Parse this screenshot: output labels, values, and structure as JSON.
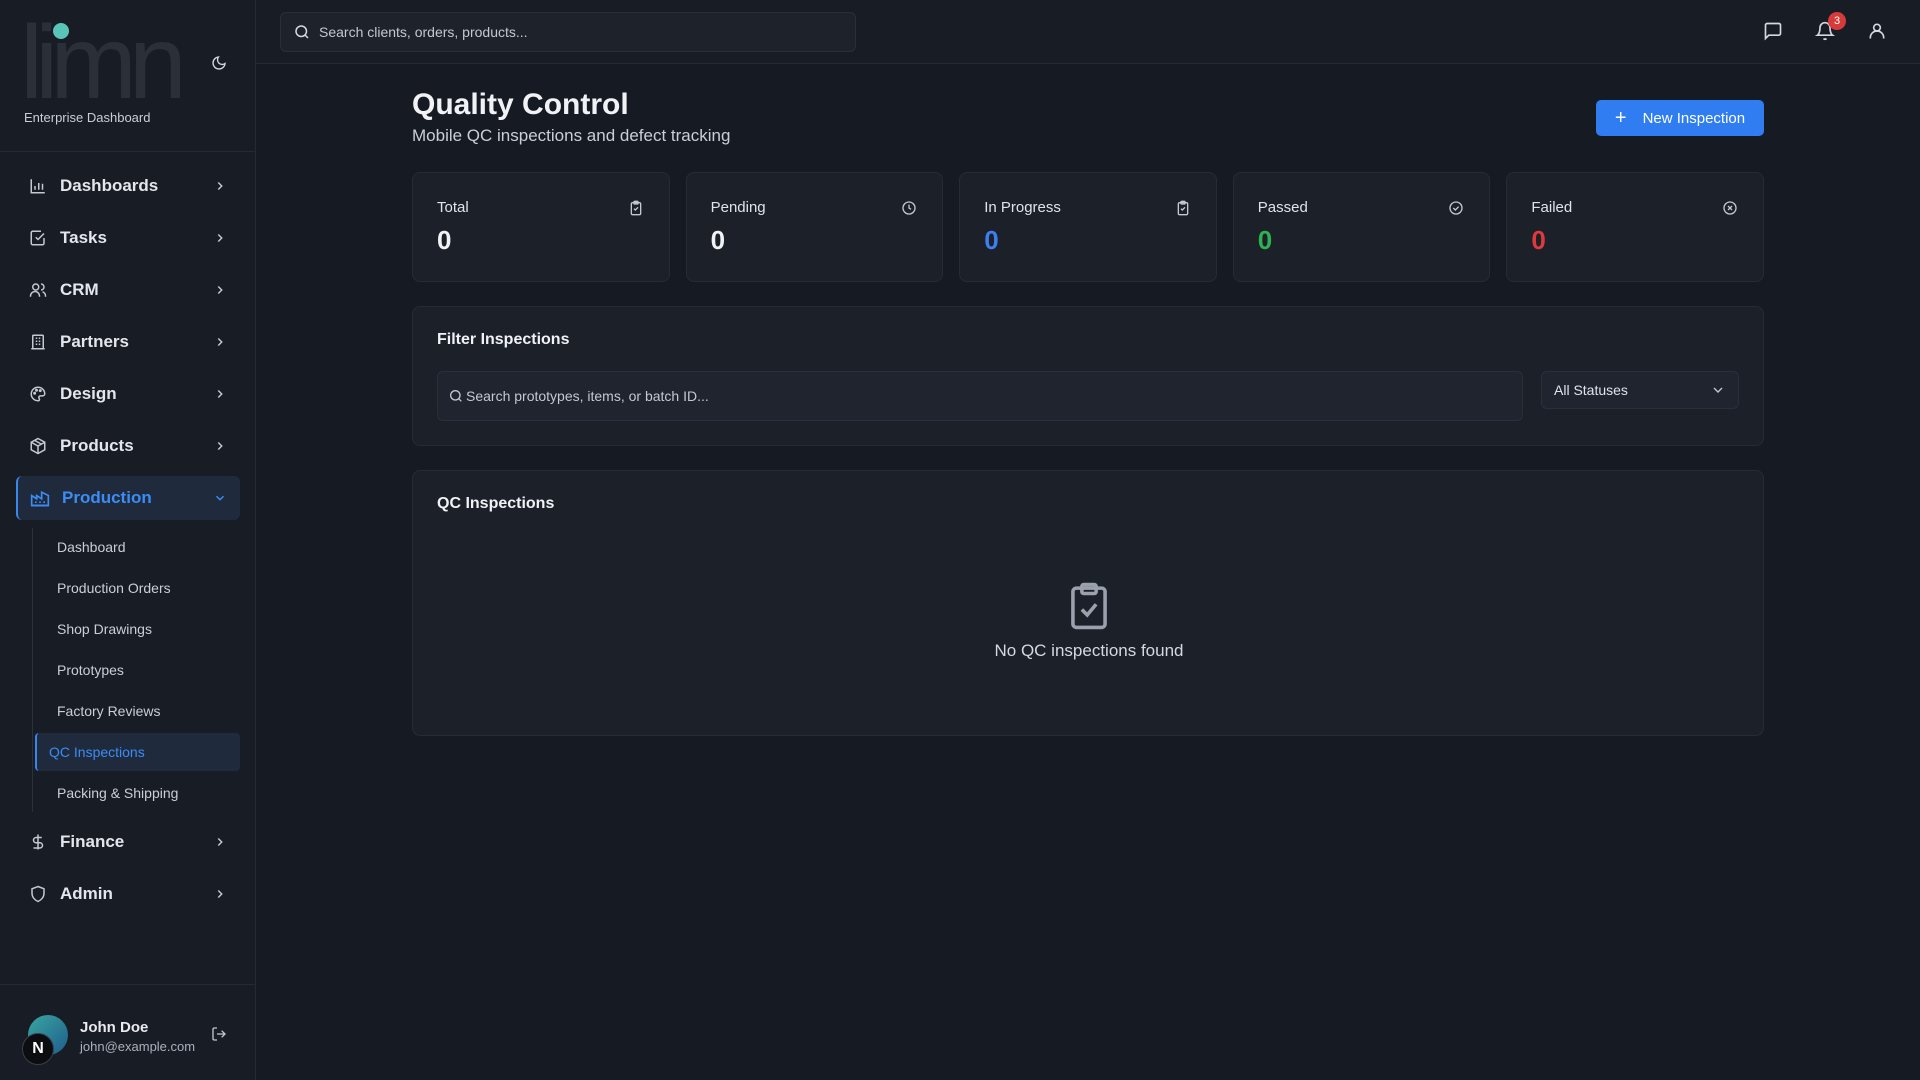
{
  "brand": {
    "logo_text": "limn",
    "subtitle": "Enterprise Dashboard"
  },
  "search": {
    "placeholder": "Search clients, orders, products..."
  },
  "notifications": {
    "count": "3"
  },
  "nav": {
    "items": [
      {
        "label": "Dashboards",
        "icon": "bar-chart-icon"
      },
      {
        "label": "Tasks",
        "icon": "check-square-icon"
      },
      {
        "label": "CRM",
        "icon": "users-icon"
      },
      {
        "label": "Partners",
        "icon": "building-icon"
      },
      {
        "label": "Design",
        "icon": "palette-icon"
      },
      {
        "label": "Products",
        "icon": "package-icon"
      },
      {
        "label": "Production",
        "icon": "factory-icon",
        "active": true
      },
      {
        "label": "Finance",
        "icon": "dollar-icon"
      },
      {
        "label": "Admin",
        "icon": "shield-icon"
      }
    ],
    "production_sub": [
      {
        "label": "Dashboard"
      },
      {
        "label": "Production Orders"
      },
      {
        "label": "Shop Drawings"
      },
      {
        "label": "Prototypes"
      },
      {
        "label": "Factory Reviews"
      },
      {
        "label": "QC Inspections",
        "active": true
      },
      {
        "label": "Packing & Shipping"
      }
    ]
  },
  "user": {
    "initial": "N",
    "name": "John Doe",
    "email": "john@example.com"
  },
  "page": {
    "title": "Quality Control",
    "subtitle": "Mobile QC inspections and defect tracking",
    "new_button": "New Inspection"
  },
  "stats": [
    {
      "label": "Total",
      "value": "0",
      "color": "#f0f2f5",
      "icon": "clipboard-check-icon"
    },
    {
      "label": "Pending",
      "value": "0",
      "color": "#f0f2f5",
      "icon": "clock-icon"
    },
    {
      "label": "In Progress",
      "value": "0",
      "color": "#3b7ff0",
      "icon": "clipboard-check-icon"
    },
    {
      "label": "Passed",
      "value": "0",
      "color": "#2fb150",
      "icon": "check-circle-icon"
    },
    {
      "label": "Failed",
      "value": "0",
      "color": "#e0393d",
      "icon": "x-circle-icon"
    }
  ],
  "filter": {
    "title": "Filter Inspections",
    "search_placeholder": "Search prototypes, items, or batch ID...",
    "status_value": "All Statuses"
  },
  "list": {
    "title": "QC Inspections",
    "empty_text": "No QC inspections found"
  },
  "colors": {
    "accent": "#2f7df0",
    "background": "#161a22",
    "sidebar": "#181c24"
  }
}
